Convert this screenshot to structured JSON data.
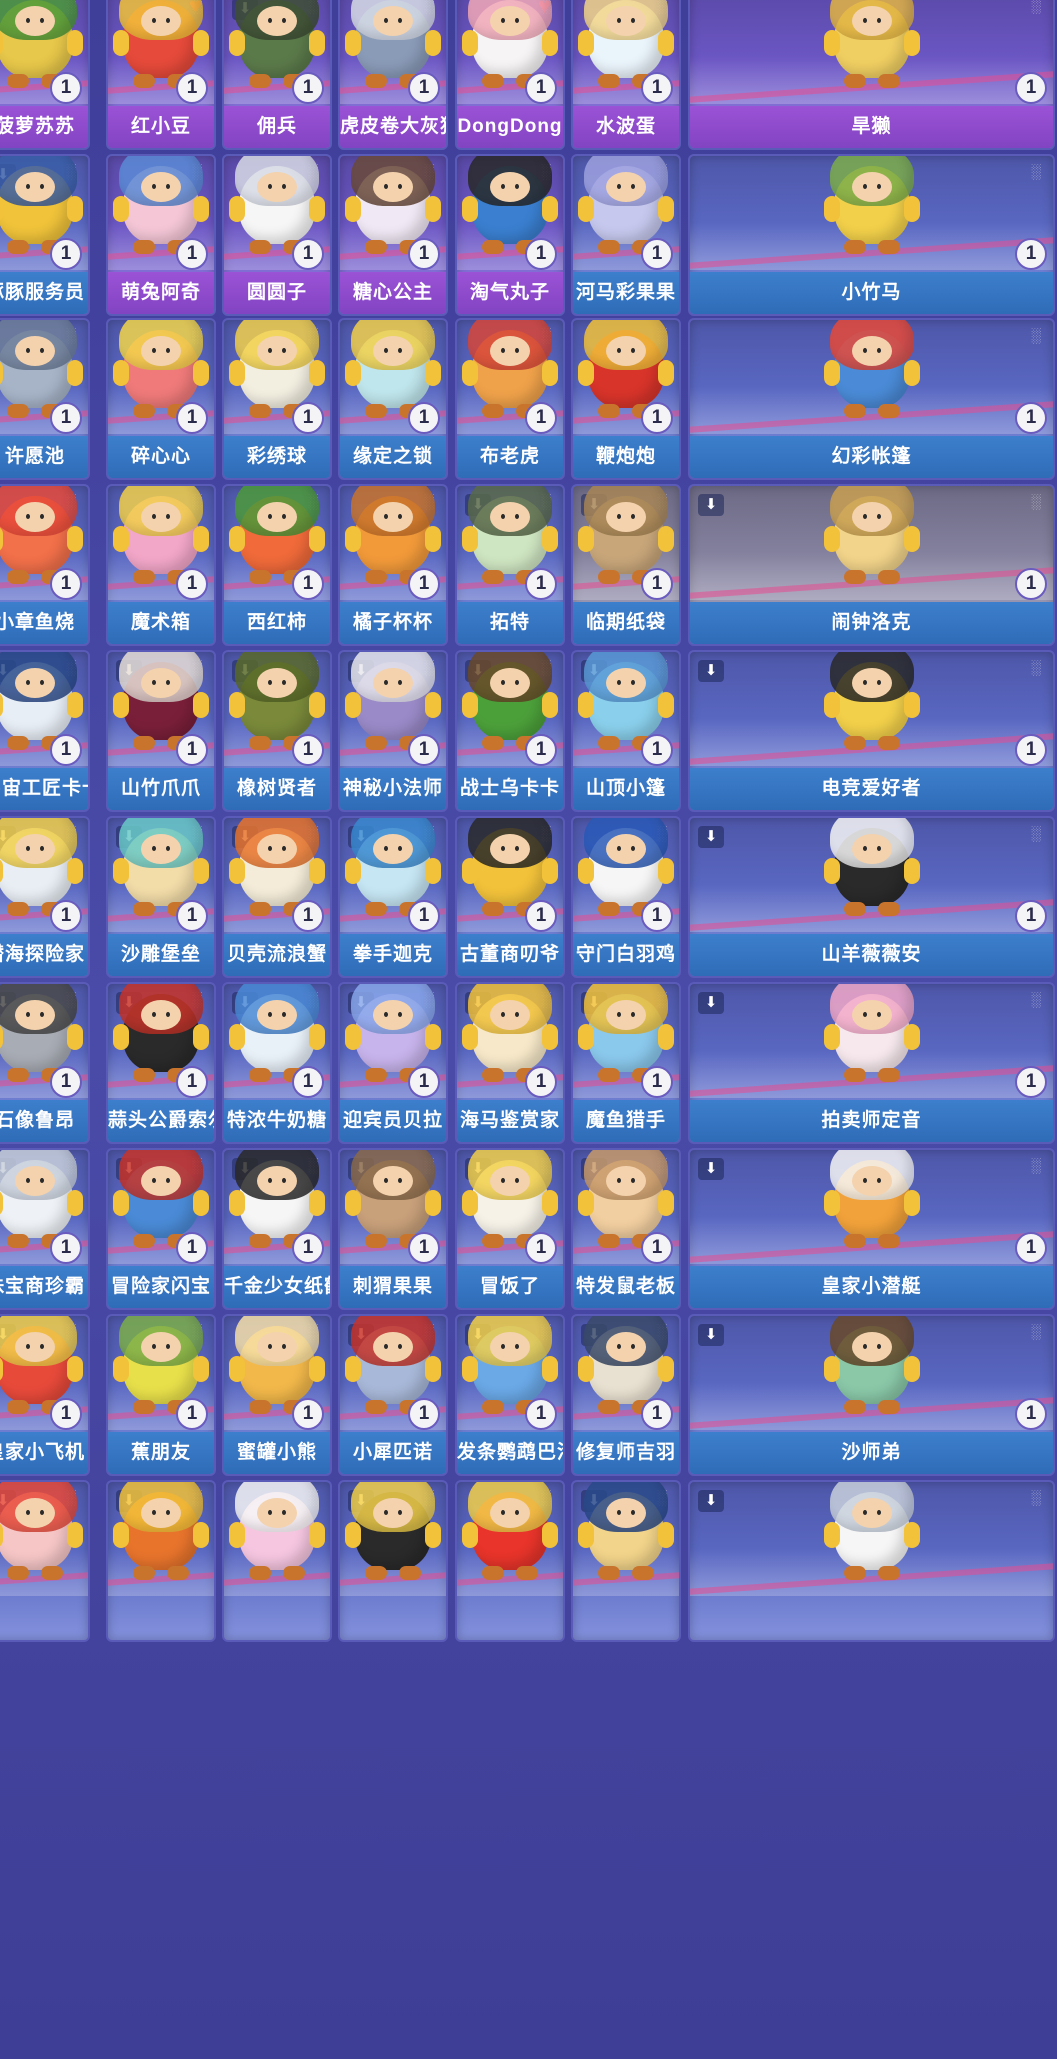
{
  "grid": {
    "rows": [
      [
        {
          "name": "菠萝苏苏",
          "count": "1",
          "frame": "purple",
          "favorite": false,
          "download": false,
          "color": "#e8c84a",
          "accent": "#4c9a3a"
        },
        {
          "name": "红小豆",
          "count": "1",
          "frame": "purple",
          "favorite": true,
          "download": false,
          "color": "#e64a3a",
          "accent": "#f2c23a"
        },
        {
          "name": "佣兵",
          "count": "1",
          "frame": "purple",
          "favorite": false,
          "download": true,
          "color": "#5b7a4a",
          "accent": "#3f4f36"
        },
        {
          "name": "虎皮卷大灰狼",
          "count": "1",
          "frame": "purple",
          "favorite": false,
          "download": false,
          "color": "#8a9bb8",
          "accent": "#d8dde8"
        },
        {
          "name": "DongDong",
          "count": "1",
          "frame": "purple",
          "favorite": true,
          "download": false,
          "color": "#f6f4f4",
          "accent": "#f2a8b8"
        },
        {
          "name": "水波蛋",
          "count": "1",
          "frame": "purple",
          "favorite": false,
          "download": false,
          "color": "#eaf4fb",
          "accent": "#f3d68a"
        },
        {
          "name": "旱獭",
          "count": "1",
          "frame": "purple",
          "favorite": false,
          "download": false,
          "color": "#f0cf62",
          "accent": "#e3b544"
        }
      ],
      [
        {
          "name": "豚豚服务员",
          "count": "1",
          "frame": "blue",
          "favorite": false,
          "download": true,
          "color": "#f0c33a",
          "accent": "#3a5fa8"
        },
        {
          "name": "萌兔阿奇",
          "count": "1",
          "frame": "purple",
          "favorite": false,
          "download": false,
          "color": "#f4c6d6",
          "accent": "#5b8bd6"
        },
        {
          "name": "圆圆子",
          "count": "1",
          "frame": "purple",
          "favorite": false,
          "download": false,
          "color": "#f6f6f6",
          "accent": "#d8dbe6"
        },
        {
          "name": "糖心公主",
          "count": "1",
          "frame": "purple",
          "favorite": false,
          "download": false,
          "color": "#f0e8f4",
          "accent": "#6a4a3a"
        },
        {
          "name": "淘气丸子",
          "count": "1",
          "frame": "purple",
          "favorite": false,
          "download": false,
          "color": "#3a7fd0",
          "accent": "#2a2a2a"
        },
        {
          "name": "河马彩果果",
          "count": "1",
          "frame": "blue",
          "favorite": false,
          "download": false,
          "color": "#c6c8ee",
          "accent": "#9ea2e0"
        },
        {
          "name": "小竹马",
          "count": "1",
          "frame": "blue",
          "favorite": false,
          "download": false,
          "color": "#f2d04a",
          "accent": "#7cae4a"
        }
      ],
      [
        {
          "name": "许愿池",
          "count": "1",
          "frame": "blue",
          "favorite": false,
          "download": false,
          "color": "#a7b4c8",
          "accent": "#6f7f9a"
        },
        {
          "name": "碎心心",
          "count": "1",
          "frame": "blue",
          "favorite": false,
          "download": false,
          "color": "#f07a7a",
          "accent": "#f3d64a"
        },
        {
          "name": "彩绣球",
          "count": "1",
          "frame": "blue",
          "favorite": false,
          "download": false,
          "color": "#f2eee0",
          "accent": "#f2d04a"
        },
        {
          "name": "缘定之锁",
          "count": "1",
          "frame": "blue",
          "favorite": false,
          "download": false,
          "color": "#bfe6ec",
          "accent": "#f2d04a"
        },
        {
          "name": "布老虎",
          "count": "1",
          "frame": "blue",
          "favorite": false,
          "download": false,
          "color": "#f0a24a",
          "accent": "#d8473a"
        },
        {
          "name": "鞭炮炮",
          "count": "1",
          "frame": "blue",
          "favorite": false,
          "download": false,
          "color": "#d8342a",
          "accent": "#f2c23a"
        },
        {
          "name": "幻彩帐篷",
          "count": "1",
          "frame": "blue",
          "favorite": false,
          "download": false,
          "color": "#4a8ad6",
          "accent": "#e64a3a"
        }
      ],
      [
        {
          "name": "小章鱼烧",
          "count": "1",
          "frame": "blue",
          "favorite": false,
          "download": false,
          "color": "#f2704a",
          "accent": "#e84a3a"
        },
        {
          "name": "魔术箱",
          "count": "1",
          "frame": "blue",
          "favorite": false,
          "download": false,
          "color": "#f2a6c8",
          "accent": "#f2d04a"
        },
        {
          "name": "西红柿",
          "count": "1",
          "frame": "blue",
          "favorite": false,
          "download": false,
          "color": "#f06a3a",
          "accent": "#4c9a3a"
        },
        {
          "name": "橘子杯杯",
          "count": "1",
          "frame": "blue",
          "favorite": false,
          "download": false,
          "color": "#f29a3a",
          "accent": "#c9742c"
        },
        {
          "name": "拓特",
          "count": "1",
          "frame": "blue",
          "favorite": false,
          "download": true,
          "color": "#cfe6c2",
          "accent": "#5a6a4a"
        },
        {
          "name": "临期纸袋",
          "count": "1",
          "frame": "gray",
          "favorite": false,
          "download": true,
          "color": "#c8a67a",
          "accent": "#a88656"
        },
        {
          "name": "闹钟洛克",
          "count": "1",
          "frame": "gray",
          "favorite": false,
          "download": true,
          "color": "#f2d48a",
          "accent": "#c9a052"
        }
      ],
      [
        {
          "name": "宇宙工匠卡卡",
          "count": "1",
          "frame": "blue",
          "favorite": false,
          "download": true,
          "color": "#e8eef6",
          "accent": "#2a4a8a"
        },
        {
          "name": "山竹爪爪",
          "count": "1",
          "frame": "blue",
          "favorite": false,
          "download": true,
          "color": "#7a1f3a",
          "accent": "#e8e0d8"
        },
        {
          "name": "橡树贤者",
          "count": "1",
          "frame": "blue",
          "favorite": false,
          "download": true,
          "color": "#7a8a3a",
          "accent": "#5a6a2a"
        },
        {
          "name": "神秘小法师",
          "count": "1",
          "frame": "blue",
          "favorite": false,
          "download": true,
          "color": "#9a8ac8",
          "accent": "#e8e8ee"
        },
        {
          "name": "战士乌卡卡",
          "count": "1",
          "frame": "blue",
          "favorite": false,
          "download": true,
          "color": "#4ca03a",
          "accent": "#6a4a2a"
        },
        {
          "name": "山顶小篷",
          "count": "1",
          "frame": "blue",
          "favorite": false,
          "download": true,
          "color": "#8ad0ec",
          "accent": "#5a9ad6"
        },
        {
          "name": "电竞爱好者",
          "count": "1",
          "frame": "blue",
          "favorite": false,
          "download": true,
          "color": "#f2d04a",
          "accent": "#2a2a2a"
        }
      ],
      [
        {
          "name": "潜海探险家",
          "count": "1",
          "frame": "blue",
          "favorite": false,
          "download": true,
          "color": "#e8eef4",
          "accent": "#f2d04a"
        },
        {
          "name": "沙雕堡垒",
          "count": "1",
          "frame": "blue",
          "favorite": false,
          "download": true,
          "color": "#f2dca8",
          "accent": "#6acac8"
        },
        {
          "name": "贝壳流浪蟹",
          "count": "1",
          "frame": "blue",
          "favorite": false,
          "download": true,
          "color": "#f4ecd8",
          "accent": "#e8742c"
        },
        {
          "name": "拳手迦克",
          "count": "1",
          "frame": "blue",
          "favorite": false,
          "download": true,
          "color": "#c6e6f4",
          "accent": "#3a8ad0"
        },
        {
          "name": "古董商叨爷",
          "count": "1",
          "frame": "blue",
          "favorite": false,
          "download": false,
          "color": "#f2c23a",
          "accent": "#2a2a2a"
        },
        {
          "name": "守门白羽鸡",
          "count": "1",
          "frame": "blue",
          "favorite": false,
          "download": false,
          "color": "#f6f6f6",
          "accent": "#2a5ab8"
        },
        {
          "name": "山羊薇薇安",
          "count": "1",
          "frame": "blue",
          "favorite": false,
          "download": true,
          "color": "#2a2a2a",
          "accent": "#f6f6f6"
        }
      ],
      [
        {
          "name": "石像鲁昂",
          "count": "1",
          "frame": "blue",
          "favorite": false,
          "download": true,
          "color": "#a8acb4",
          "accent": "#4a4a4a"
        },
        {
          "name": "蒜头公爵索尔",
          "count": "1",
          "frame": "blue",
          "favorite": false,
          "download": true,
          "color": "#2a2a2a",
          "accent": "#c8342a"
        },
        {
          "name": "特浓牛奶糖",
          "count": "1",
          "frame": "blue",
          "favorite": false,
          "download": true,
          "color": "#e8f0f8",
          "accent": "#4a8ad6"
        },
        {
          "name": "迎宾员贝拉",
          "count": "1",
          "frame": "blue",
          "favorite": false,
          "download": true,
          "color": "#c8b4ec",
          "accent": "#8aa8ec"
        },
        {
          "name": "海马鉴赏家",
          "count": "1",
          "frame": "blue",
          "favorite": false,
          "download": true,
          "color": "#f6e8c8",
          "accent": "#f2c23a"
        },
        {
          "name": "魔鱼猎手",
          "count": "1",
          "frame": "blue",
          "favorite": false,
          "download": true,
          "color": "#8ac8ec",
          "accent": "#f2c23a"
        },
        {
          "name": "拍卖师定音",
          "count": "1",
          "frame": "blue",
          "favorite": false,
          "download": true,
          "color": "#f6e8ec",
          "accent": "#f2a8c8"
        }
      ],
      [
        {
          "name": "珠宝商珍霸",
          "count": "1",
          "frame": "blue",
          "favorite": false,
          "download": true,
          "color": "#eef2f6",
          "accent": "#c8d0dc"
        },
        {
          "name": "冒险家闪宝",
          "count": "1",
          "frame": "blue",
          "favorite": false,
          "download": true,
          "color": "#4a8ad6",
          "accent": "#c8342a"
        },
        {
          "name": "千金少女纸鹤",
          "count": "1",
          "frame": "blue",
          "favorite": false,
          "download": true,
          "color": "#f6f6f6",
          "accent": "#2a2a2a"
        },
        {
          "name": "刺猬果果",
          "count": "1",
          "frame": "blue",
          "favorite": false,
          "download": true,
          "color": "#c8a07a",
          "accent": "#8a6a4a"
        },
        {
          "name": "冒饭了",
          "count": "1",
          "frame": "blue",
          "favorite": false,
          "download": true,
          "color": "#f6f2e8",
          "accent": "#f2d04a"
        },
        {
          "name": "特发鼠老板",
          "count": "1",
          "frame": "blue",
          "favorite": false,
          "download": true,
          "color": "#f2cfa0",
          "accent": "#c89a6a"
        },
        {
          "name": "皇家小潜艇",
          "count": "1",
          "frame": "blue",
          "favorite": false,
          "download": true,
          "color": "#f2a23a",
          "accent": "#f6f6f6"
        }
      ],
      [
        {
          "name": "皇家小飞机",
          "count": "1",
          "frame": "blue",
          "favorite": false,
          "download": true,
          "color": "#e84a3a",
          "accent": "#f2d04a"
        },
        {
          "name": "蕉朋友",
          "count": "1",
          "frame": "blue",
          "favorite": false,
          "download": false,
          "color": "#e8e04a",
          "accent": "#7cae4a"
        },
        {
          "name": "蜜罐小熊",
          "count": "1",
          "frame": "blue",
          "favorite": false,
          "download": false,
          "color": "#f2b84a",
          "accent": "#f6e0a8"
        },
        {
          "name": "小犀匹诺",
          "count": "1",
          "frame": "blue",
          "favorite": false,
          "download": true,
          "color": "#a8b8d8",
          "accent": "#c8342a"
        },
        {
          "name": "发条鹦鹉巴洛",
          "count": "1",
          "frame": "blue",
          "favorite": false,
          "download": true,
          "color": "#6aa8e6",
          "accent": "#f2d04a"
        },
        {
          "name": "修复师吉羽",
          "count": "1",
          "frame": "blue",
          "favorite": false,
          "download": true,
          "color": "#e8e0d0",
          "accent": "#3a4a6a"
        },
        {
          "name": "沙师弟",
          "count": "1",
          "frame": "blue",
          "favorite": false,
          "download": true,
          "color": "#8ac8a8",
          "accent": "#6a4a2a"
        }
      ],
      [
        {
          "name": "",
          "count": "",
          "frame": "blue",
          "favorite": false,
          "download": true,
          "color": "#f6c6c6",
          "accent": "#e84a3a"
        },
        {
          "name": "",
          "count": "",
          "frame": "blue",
          "favorite": false,
          "download": true,
          "color": "#e8742c",
          "accent": "#f2c23a"
        },
        {
          "name": "",
          "count": "",
          "frame": "blue",
          "favorite": false,
          "download": false,
          "color": "#f6c6e0",
          "accent": "#f6f6f6"
        },
        {
          "name": "",
          "count": "",
          "frame": "blue",
          "favorite": false,
          "download": true,
          "color": "#2a2a2a",
          "accent": "#f2d04a"
        },
        {
          "name": "",
          "count": "",
          "frame": "blue",
          "favorite": false,
          "download": false,
          "color": "#e8342a",
          "accent": "#f2d04a"
        },
        {
          "name": "",
          "count": "",
          "frame": "blue",
          "favorite": false,
          "download": true,
          "color": "#f2d48a",
          "accent": "#2a4a8a"
        },
        {
          "name": "",
          "count": "",
          "frame": "blue",
          "favorite": false,
          "download": true,
          "color": "#f6f6f6",
          "accent": "#c8d0dc"
        }
      ]
    ]
  }
}
